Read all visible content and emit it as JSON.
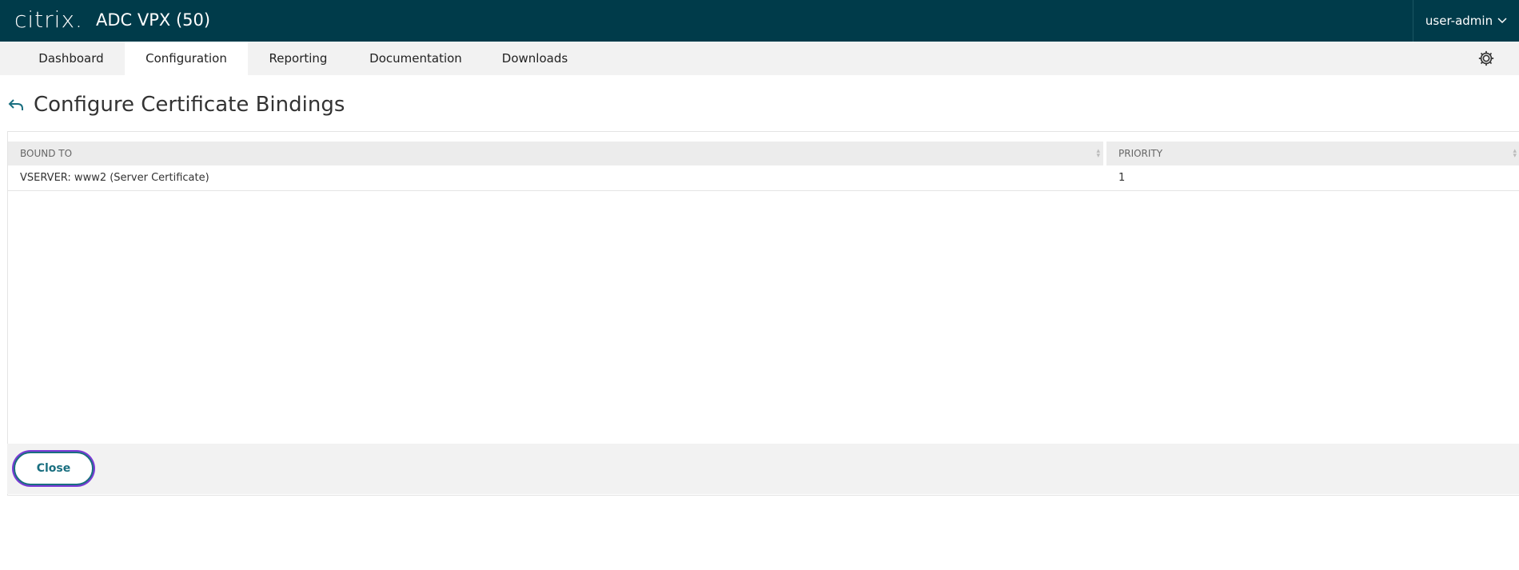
{
  "header": {
    "logo": "citrix.",
    "product": "ADC VPX (50)",
    "user": "user-admin"
  },
  "nav": {
    "tabs": [
      {
        "label": "Dashboard"
      },
      {
        "label": "Configuration"
      },
      {
        "label": "Reporting"
      },
      {
        "label": "Documentation"
      },
      {
        "label": "Downloads"
      }
    ],
    "active_tab": "Configuration"
  },
  "page": {
    "title": "Configure Certificate Bindings"
  },
  "table": {
    "columns": [
      {
        "label": "BOUND TO"
      },
      {
        "label": "PRIORITY"
      }
    ],
    "rows": [
      {
        "bound_to": "VSERVER: www2 (Server Certificate)",
        "priority": "1"
      }
    ]
  },
  "footer": {
    "close_label": "Close"
  },
  "colors": {
    "header_bg": "#003b4a",
    "accent": "#1a6f80",
    "focus_ring": "#7b3bd6"
  },
  "icons": {
    "back": "back-arrow-icon",
    "settings": "gear-icon",
    "user_menu": "chevron-down-icon"
  }
}
